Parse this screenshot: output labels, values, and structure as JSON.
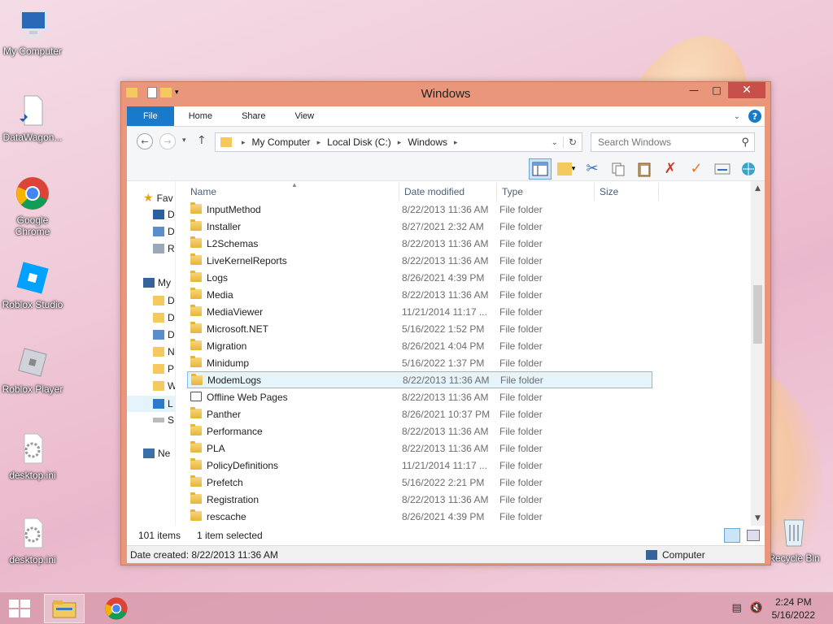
{
  "desktop": {
    "icons": [
      {
        "label": "My Computer",
        "icon": "computer-icon"
      },
      {
        "label": "DataWagon...",
        "icon": "file-shortcut-icon"
      },
      {
        "label": "Google Chrome",
        "icon": "chrome-icon"
      },
      {
        "label": "Roblox Studio",
        "icon": "roblox-studio-icon"
      },
      {
        "label": "Roblox Player",
        "icon": "roblox-player-icon"
      },
      {
        "label": "desktop.ini",
        "icon": "settings-file-icon"
      },
      {
        "label": "desktop.ini",
        "icon": "settings-file-icon"
      },
      {
        "label": "Recycle Bin",
        "icon": "recycle-bin-icon"
      }
    ]
  },
  "window": {
    "title": "Windows",
    "ribbon_tabs": [
      "File",
      "Home",
      "Share",
      "View"
    ],
    "address": {
      "crumbs": [
        "My Computer",
        "Local Disk (C:)",
        "Windows"
      ]
    },
    "search_placeholder": "Search Windows",
    "columns": {
      "name": "Name",
      "date": "Date modified",
      "type": "Type",
      "size": "Size"
    },
    "nav": [
      "Fav",
      "D",
      "D",
      "R",
      "My",
      "D",
      "D",
      "D",
      "N",
      "P",
      "W",
      "L",
      "S",
      "Ne"
    ],
    "files": [
      {
        "name": "InputMethod",
        "date": "8/22/2013 11:36 AM",
        "type": "File folder"
      },
      {
        "name": "Installer",
        "date": "8/27/2021 2:32 AM",
        "type": "File folder"
      },
      {
        "name": "L2Schemas",
        "date": "8/22/2013 11:36 AM",
        "type": "File folder"
      },
      {
        "name": "LiveKernelReports",
        "date": "8/22/2013 11:36 AM",
        "type": "File folder"
      },
      {
        "name": "Logs",
        "date": "8/26/2021 4:39 PM",
        "type": "File folder"
      },
      {
        "name": "Media",
        "date": "8/22/2013 11:36 AM",
        "type": "File folder"
      },
      {
        "name": "MediaViewer",
        "date": "11/21/2014 11:17 ...",
        "type": "File folder"
      },
      {
        "name": "Microsoft.NET",
        "date": "5/16/2022 1:52 PM",
        "type": "File folder"
      },
      {
        "name": "Migration",
        "date": "8/26/2021 4:04 PM",
        "type": "File folder"
      },
      {
        "name": "Minidump",
        "date": "5/16/2022 1:37 PM",
        "type": "File folder"
      },
      {
        "name": "ModemLogs",
        "date": "8/22/2013 11:36 AM",
        "type": "File folder",
        "selected": true
      },
      {
        "name": "Offline Web Pages",
        "date": "8/22/2013 11:36 AM",
        "type": "File folder",
        "icon": "web"
      },
      {
        "name": "Panther",
        "date": "8/26/2021 10:37 PM",
        "type": "File folder"
      },
      {
        "name": "Performance",
        "date": "8/22/2013 11:36 AM",
        "type": "File folder"
      },
      {
        "name": "PLA",
        "date": "8/22/2013 11:36 AM",
        "type": "File folder"
      },
      {
        "name": "PolicyDefinitions",
        "date": "11/21/2014 11:17 ...",
        "type": "File folder"
      },
      {
        "name": "Prefetch",
        "date": "5/16/2022 2:21 PM",
        "type": "File folder"
      },
      {
        "name": "Registration",
        "date": "8/22/2013 11:36 AM",
        "type": "File folder"
      },
      {
        "name": "rescache",
        "date": "8/26/2021 4:39 PM",
        "type": "File folder"
      }
    ],
    "status": {
      "count": "101 items",
      "selection": "1 item selected"
    },
    "details": {
      "created": "Date created: 8/22/2013 11:36 AM",
      "location": "Computer"
    }
  },
  "taskbar": {
    "time": "2:24 PM",
    "date": "5/16/2022"
  }
}
